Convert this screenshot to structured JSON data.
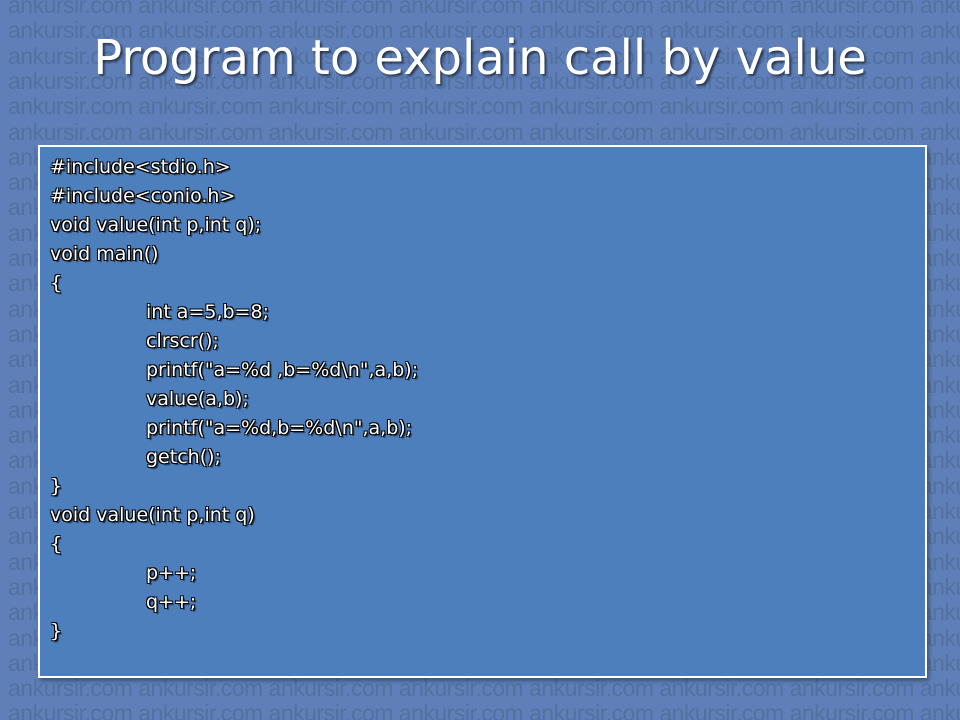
{
  "slide": {
    "title": "Program to explain call by value",
    "watermark_text": "ankursir.com"
  },
  "code": {
    "lines": [
      {
        "text": "#include<stdio.h>",
        "indent": false
      },
      {
        "text": "#include<conio.h>",
        "indent": false
      },
      {
        "text": "void value(int p,int q);",
        "indent": false
      },
      {
        "text": "void main()",
        "indent": false
      },
      {
        "text": "{",
        "indent": false
      },
      {
        "text": "int a=5,b=8;",
        "indent": true
      },
      {
        "text": "clrscr();",
        "indent": true
      },
      {
        "text": "printf(\"a=%d ,b=%d\\n\",a,b);",
        "indent": true
      },
      {
        "text": "value(a,b);",
        "indent": true
      },
      {
        "text": "printf(\"a=%d,b=%d\\n\",a,b);",
        "indent": true
      },
      {
        "text": "getch();",
        "indent": true
      },
      {
        "text": "}",
        "indent": false
      },
      {
        "text": "void value(int p,int q)",
        "indent": false
      },
      {
        "text": "{",
        "indent": false
      },
      {
        "text": "p++;",
        "indent": true
      },
      {
        "text": "q++;",
        "indent": true
      },
      {
        "text": "}",
        "indent": false
      }
    ]
  },
  "colors": {
    "background": "#5f7fb9",
    "code_box": "#4e7fbd",
    "text": "#ffffff"
  }
}
